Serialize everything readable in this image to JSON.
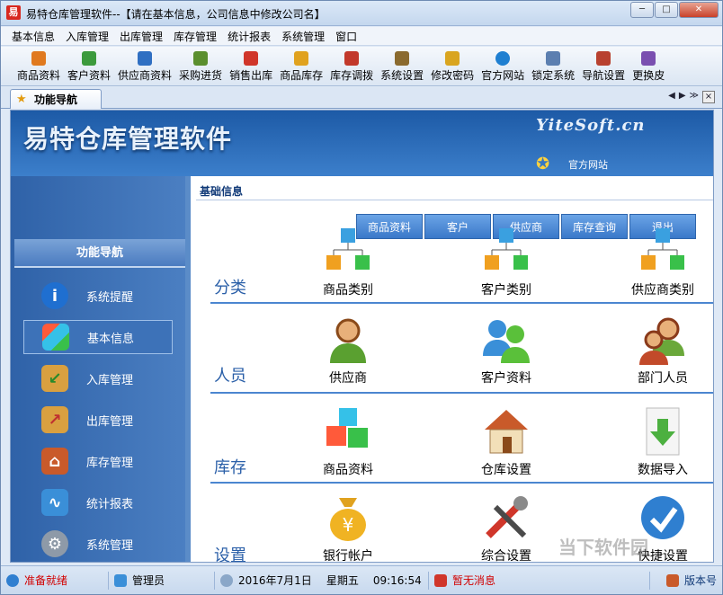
{
  "window": {
    "app_icon": "易",
    "title": "易特仓库管理软件--【请在基本信息，公司信息中修改公司名】",
    "buttons": [
      "minimize",
      "maximize",
      "close"
    ]
  },
  "menu": [
    "基本信息",
    "入库管理",
    "出库管理",
    "库存管理",
    "统计报表",
    "系统管理",
    "窗口"
  ],
  "toolbar": [
    {
      "label": "商品资料",
      "icon": "goods-icon",
      "color": "#e07a1f"
    },
    {
      "label": "客户资料",
      "icon": "customers-icon",
      "color": "#3c9a3c"
    },
    {
      "label": "供应商资料",
      "icon": "suppliers-icon",
      "color": "#2f6fc2"
    },
    {
      "label": "采购进货",
      "icon": "purchase-icon",
      "color": "#5b8f2e"
    },
    {
      "label": "销售出库",
      "icon": "sales-icon",
      "color": "#d0362a"
    },
    {
      "label": "商品库存",
      "icon": "stock-icon",
      "color": "#e0a21f"
    },
    {
      "label": "库存调拨",
      "icon": "transfer-icon",
      "color": "#c2392b"
    },
    {
      "label": "系统设置",
      "icon": "settings-icon",
      "color": "#8a6a2e"
    },
    {
      "label": "修改密码",
      "icon": "password-icon",
      "color": "#d9a520"
    },
    {
      "label": "官方网站",
      "icon": "ie-icon",
      "color": "#1f7fd1"
    },
    {
      "label": "锁定系统",
      "icon": "lock-icon",
      "color": "#5c7fb0"
    },
    {
      "label": "导航设置",
      "icon": "navigation-icon",
      "color": "#b8412f"
    },
    {
      "label": "更换皮",
      "icon": "skin-icon",
      "color": "#7a4fb0"
    }
  ],
  "tab": {
    "label": "功能导航"
  },
  "banner": {
    "title": "易特仓库管理软件",
    "site": "YiteSoft.cn",
    "site_link": "官方网站"
  },
  "nav": {
    "header": "功能导航",
    "items": [
      {
        "label": "系统提醒",
        "icon": "info-icon",
        "color": "#1f6fd0",
        "active": false
      },
      {
        "label": "基本信息",
        "icon": "cubes-icon",
        "color": "#2fa0c8",
        "active": true
      },
      {
        "label": "入库管理",
        "icon": "box-in-icon",
        "color": "#d9a040",
        "active": false
      },
      {
        "label": "出库管理",
        "icon": "box-out-icon",
        "color": "#d9a040",
        "active": false
      },
      {
        "label": "库存管理",
        "icon": "house-icon",
        "color": "#c95a2a",
        "active": false
      },
      {
        "label": "统计报表",
        "icon": "chart-icon",
        "color": "#3a8fd8",
        "active": false
      },
      {
        "label": "系统管理",
        "icon": "gears-icon",
        "color": "#8e9aa8",
        "active": false
      }
    ]
  },
  "main": {
    "section_title": "基础信息",
    "quick_buttons": [
      "商品资料",
      "客户",
      "供应商",
      "库存查询",
      "退出"
    ],
    "rows": [
      {
        "label": "分类",
        "tiles": [
          "商品类别",
          "客户类别",
          "供应商类别"
        ]
      },
      {
        "label": "人员",
        "tiles": [
          "供应商",
          "客户资料",
          "部门人员"
        ]
      },
      {
        "label": "库存",
        "tiles": [
          "商品资料",
          "仓库设置",
          "数据导入"
        ]
      },
      {
        "label": "设置",
        "tiles": [
          "银行帐户",
          "综合设置",
          "快捷设置"
        ]
      }
    ]
  },
  "status": {
    "ready": "准备就绪",
    "user": "管理员",
    "date": "2016年7月1日",
    "weekday": "星期五",
    "time": "09:16:54",
    "message": "暂无消息",
    "version": "版本号"
  },
  "watermark": "当下软件园"
}
